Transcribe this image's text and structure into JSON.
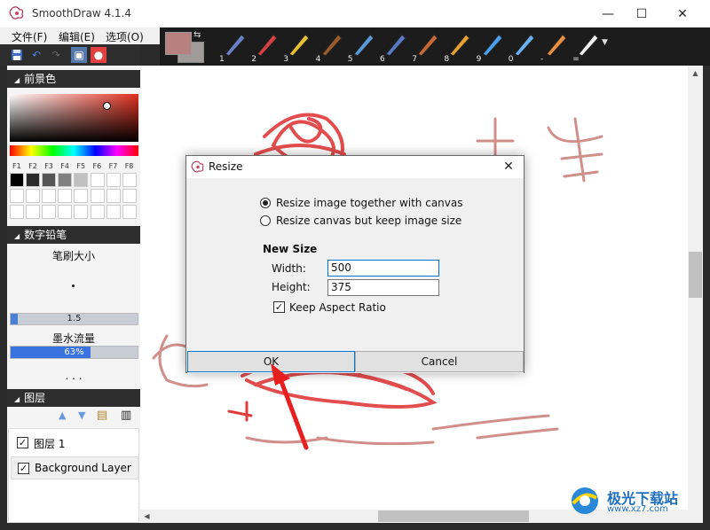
{
  "app": {
    "title": "SmoothDraw 4.1.4"
  },
  "window_controls": {
    "minimize": "—",
    "maximize": "☐",
    "close": "✕"
  },
  "menu": [
    {
      "label": "文件(F)"
    },
    {
      "label": "编辑(E)"
    },
    {
      "label": "选项(O)"
    }
  ],
  "toolbar": {
    "tools": [
      {
        "num": "1",
        "icon": "pen-icon"
      },
      {
        "num": "2",
        "icon": "pencil-icon"
      },
      {
        "num": "3",
        "icon": "marker-icon"
      },
      {
        "num": "4",
        "icon": "brush-icon"
      },
      {
        "num": "5",
        "icon": "airbrush-icon"
      },
      {
        "num": "6",
        "icon": "spray-icon"
      },
      {
        "num": "7",
        "icon": "oil-brush-icon"
      },
      {
        "num": "8",
        "icon": "ink-brush-icon"
      },
      {
        "num": "9",
        "icon": "sparkle-icon"
      },
      {
        "num": "0",
        "icon": "water-drop-icon"
      },
      {
        "num": "-",
        "icon": "blur-icon"
      },
      {
        "num": "=",
        "icon": "eraser-icon"
      }
    ],
    "colors": {
      "foreground": "#b8817f",
      "background": "#a09a99"
    }
  },
  "sidebar": {
    "foreground_panel": {
      "title": "前景色"
    },
    "swatch_labels": [
      "F1",
      "F2",
      "F3",
      "F4",
      "F5",
      "F6",
      "F7",
      "F8"
    ],
    "brush_panel": {
      "title": "数字铅笔",
      "size_label": "笔刷大小",
      "size_value": "1.5",
      "flow_label": "墨水流量",
      "flow_value": "63%",
      "flow_fraction": 0.63,
      "more": ". . ."
    },
    "layers_panel": {
      "title": "图层",
      "layers": [
        {
          "name": "图层 1",
          "checked": true
        },
        {
          "name": "Background Layer",
          "checked": true
        }
      ]
    }
  },
  "dialog": {
    "title": "Resize",
    "option_resize_image": "Resize image together with canvas",
    "option_resize_canvas": "Resize canvas but keep image size",
    "new_size_label": "New Size",
    "width_label": "Width:",
    "width_value": "500",
    "height_label": "Height:",
    "height_value": "375",
    "keep_aspect_label": "Keep Aspect Ratio",
    "ok_label": "OK",
    "cancel_label": "Cancel"
  },
  "watermark": {
    "text": "极光下载站",
    "url": "www.xz7.com"
  }
}
